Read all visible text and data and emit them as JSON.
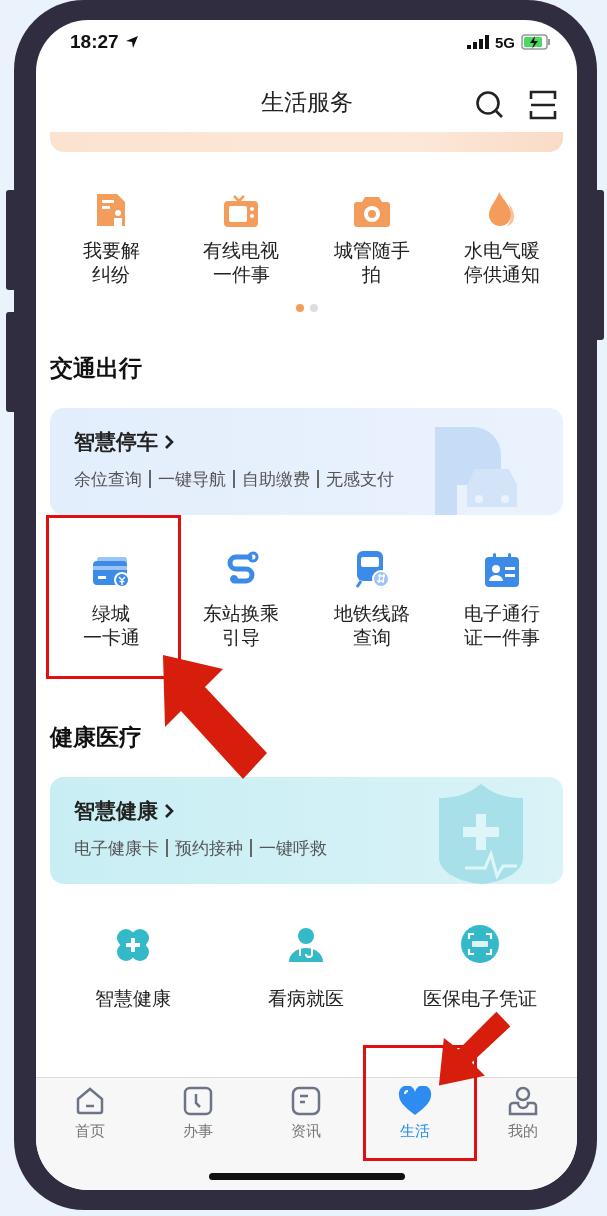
{
  "status_bar": {
    "time": "18:27",
    "network": "5G"
  },
  "header": {
    "title": "生活服务"
  },
  "top_services": [
    {
      "label": [
        "我要解",
        "纠纷"
      ],
      "highlighted": false
    },
    {
      "label": [
        "有线电视",
        "一件事"
      ],
      "highlighted": false
    },
    {
      "label": [
        "城管随手",
        "拍"
      ],
      "highlighted": false
    },
    {
      "label": [
        "水电气暖",
        "停供通知"
      ],
      "highlighted": false
    }
  ],
  "pager": [
    {
      "selected": true
    },
    {
      "selected": false
    }
  ],
  "sections": [
    {
      "title": "交通出行",
      "card": {
        "kind": "parking",
        "title": "智慧停车",
        "links": [
          "余位查询",
          "一键导航",
          "自助缴费",
          "无感支付"
        ]
      },
      "services": [
        {
          "label": [
            "绿城",
            "一卡通"
          ],
          "highlighted": true
        },
        {
          "label": [
            "东站换乘",
            "引导"
          ],
          "highlighted": false
        },
        {
          "label": [
            "地铁线路",
            "查询"
          ],
          "highlighted": false
        },
        {
          "label": [
            "电子通行",
            "证一件事"
          ],
          "highlighted": false
        }
      ]
    },
    {
      "title": "健康医疗",
      "card": {
        "kind": "health",
        "title": "智慧健康",
        "links": [
          "电子健康卡",
          "预约接种",
          "一键呼救"
        ]
      },
      "services": [
        {
          "label": [
            "智慧健康"
          ],
          "highlighted": false
        },
        {
          "label": [
            "看病就医"
          ],
          "highlighted": false
        },
        {
          "label": [
            "医保电子凭证"
          ],
          "highlighted": false
        }
      ]
    }
  ],
  "tabs": [
    {
      "label": "首页",
      "selected": false,
      "highlighted": false
    },
    {
      "label": "办事",
      "selected": false,
      "highlighted": false
    },
    {
      "label": "资讯",
      "selected": false,
      "highlighted": false
    },
    {
      "label": "生活",
      "selected": true,
      "highlighted": true
    },
    {
      "label": "我的",
      "selected": false,
      "highlighted": false
    }
  ]
}
